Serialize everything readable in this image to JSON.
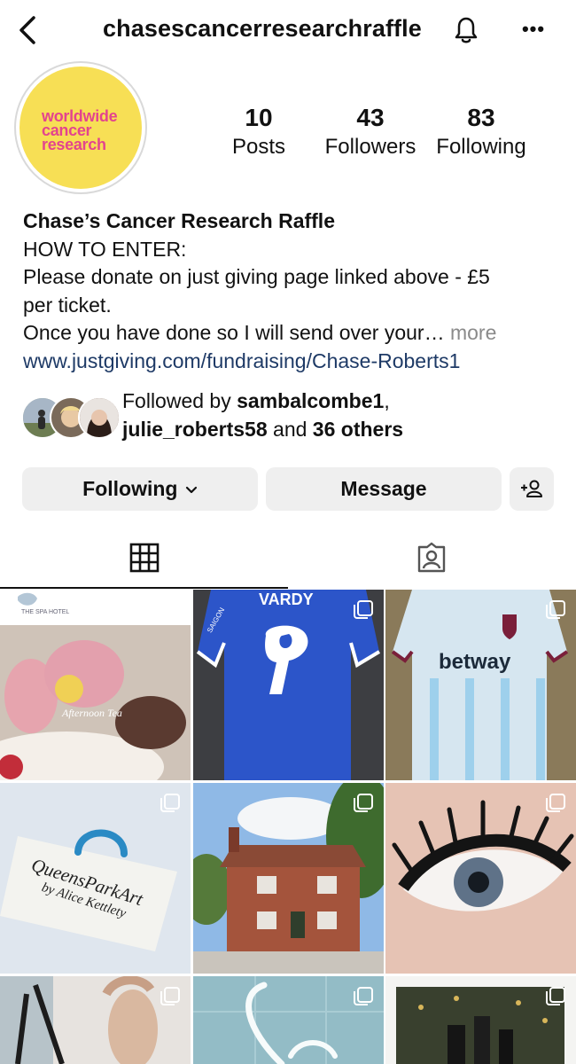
{
  "header": {
    "username": "chasescancerresearchraffle",
    "more": "•••"
  },
  "profile": {
    "avatar_text": [
      "worldwide",
      "cancer",
      "research"
    ],
    "stats": [
      {
        "num": "10",
        "label": "Posts"
      },
      {
        "num": "43",
        "label": "Followers"
      },
      {
        "num": "83",
        "label": "Following"
      }
    ],
    "name": "Chase’s Cancer Research Raffle",
    "bio_lines": [
      "HOW TO ENTER:",
      "Please donate on just giving page linked above - £5",
      "per ticket.",
      "Once you have done so I will send over your…"
    ],
    "more_label": "more",
    "link": "www.justgiving.com/fundraising/Chase-Roberts1",
    "followed_by": {
      "prefix": "Followed by ",
      "user1": "sambalcombe1",
      "comma": ",",
      "user2": "julie_roberts58",
      "and": " and ",
      "others": "36 others"
    }
  },
  "actions": {
    "following": "Following",
    "message": "Message"
  },
  "grid": {
    "tiles": [
      {
        "caption_small": "THE SPA HOTEL",
        "caption": "Afternoon Tea"
      },
      {
        "caption": "VARDY",
        "number": "9",
        "sponsor": "SAIGON"
      },
      {
        "caption": "betway"
      },
      {
        "caption_line1": "QueensParkArt",
        "caption_line2": "by Alice Kettlety"
      },
      {},
      {},
      {},
      {},
      {}
    ]
  },
  "colors": {
    "accent_yellow": "#f7df55",
    "accent_pink": "#e3448e",
    "link": "#1e3a66",
    "button_bg": "#efefef"
  }
}
